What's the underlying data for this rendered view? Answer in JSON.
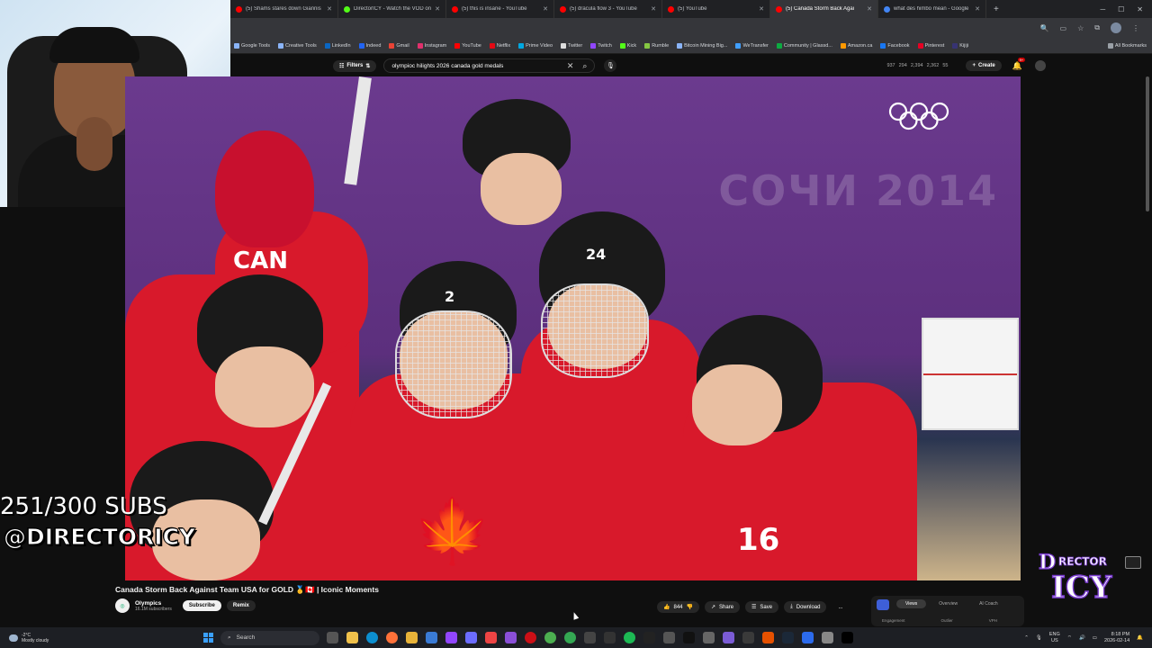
{
  "browser": {
    "tabs": [
      {
        "label": "(5) Shams stares down Giannis",
        "favicon": "#ff0000",
        "active": false
      },
      {
        "label": "DirectorICY - Watch the VOD on",
        "favicon": "#53fc18",
        "active": false
      },
      {
        "label": "(5) this is insane - YouTube",
        "favicon": "#ff0000",
        "active": false
      },
      {
        "label": "(5) dracula flow 3 - YouTube",
        "favicon": "#ff0000",
        "active": false
      },
      {
        "label": "(5) YouTube",
        "favicon": "#ff0000",
        "active": false
      },
      {
        "label": "(5) Canada Storm Back Agai",
        "favicon": "#ff0000",
        "active": true
      },
      {
        "label": "what des himbo mean - Google",
        "favicon": "#4285f4",
        "active": false
      }
    ],
    "new_tab": "+",
    "bookmarks": [
      "Google Tools",
      "Creative Tools",
      "LinkedIn",
      "Indeed",
      "Gmail",
      "Instagram",
      "YouTube",
      "Netflix",
      "Prime Video",
      "Twitter",
      "Twitch",
      "Kick",
      "Rumble",
      "Bitcoin Mining Big...",
      "WeTransfer",
      "Community | Glassd...",
      "Amazon.ca",
      "Facebook",
      "Pinterest",
      "Kijiji"
    ],
    "all_bookmarks": "All Bookmarks"
  },
  "youtube": {
    "filters_label": "Filters",
    "search_query": "olympioc hilights 2026 canada gold medals",
    "stats": [
      "937",
      "294",
      "2,394",
      "2,362",
      "55"
    ],
    "create_label": "Create",
    "notif_count": "9+"
  },
  "video": {
    "watermark": "СОЧИ 2014",
    "jersey_numbers": [
      "24",
      "2",
      "16",
      "CAN"
    ],
    "title": "Canada Storm Back Against Team USA for GOLD 🥇🇨🇦 | Iconic Moments",
    "channel_name": "Olympics",
    "channel_subs": "16.1M subscribers",
    "subscribe_label": "Subscribe",
    "remix_label": "Remix",
    "likes": "844",
    "share_label": "Share",
    "save_label": "Save",
    "download_label": "Download",
    "more_label": "..."
  },
  "analytics_panel": {
    "tabs": [
      "Views",
      "Overview",
      "AI Coach"
    ],
    "active_tab": "Views",
    "labels": [
      "Engagement",
      "Outlier",
      "VPH"
    ]
  },
  "stream_overlay": {
    "subs_goal": "251/300 SUBS",
    "handle": "@DIRECTORICY",
    "logo_text": "DIRECTOR ICY"
  },
  "taskbar": {
    "weather_temp": "-2°C",
    "weather_desc": "Mostly cloudy",
    "search_placeholder": "Search",
    "lang_top": "ENG",
    "lang_bottom": "US",
    "time": "8:18 PM",
    "date": "2026-02-14"
  },
  "colors": {
    "accent": "#ff0000",
    "jersey_red": "#d8192b",
    "background": "#0f0f0f"
  }
}
